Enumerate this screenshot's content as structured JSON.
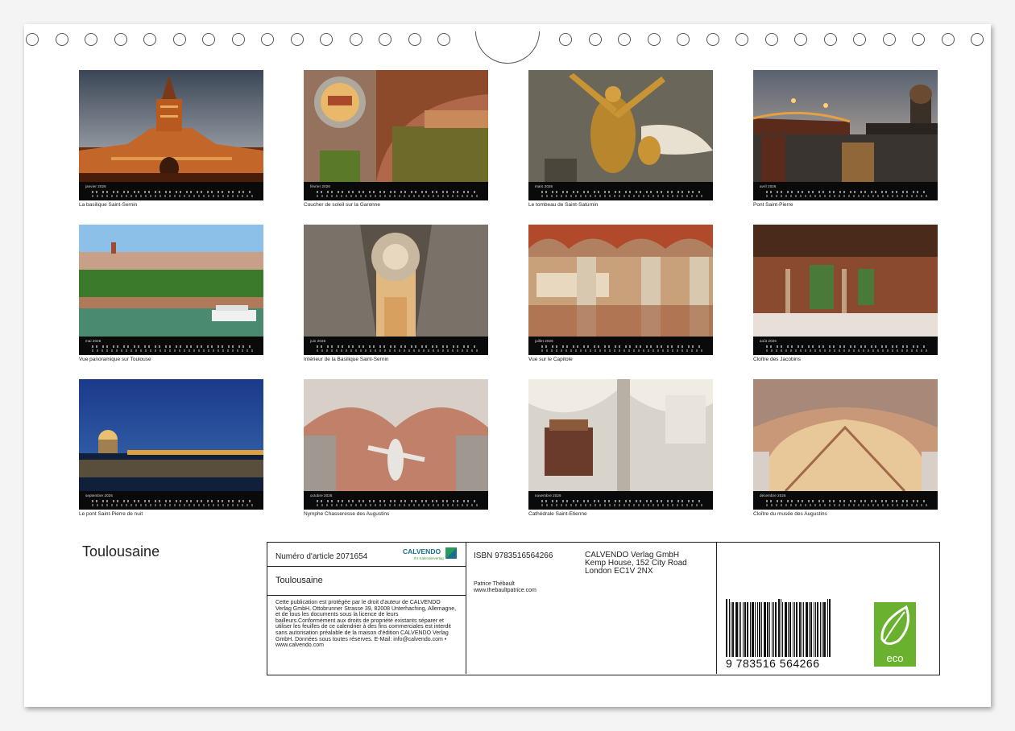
{
  "months": [
    {
      "label": "janvier 2026",
      "caption": "La basilique Saint-Sernin"
    },
    {
      "label": "février 2026",
      "caption": "Coucher de soleil sur la Garonne"
    },
    {
      "label": "mars 2026",
      "caption": "Le tombeau de Saint-Saturnin"
    },
    {
      "label": "avril 2026",
      "caption": "Pont Saint-Pierre"
    },
    {
      "label": "mai 2026",
      "caption": "Vue panoramique sur Toulouse"
    },
    {
      "label": "juin 2026",
      "caption": "Intérieur de la Basilique Saint-Sernin"
    },
    {
      "label": "juillet 2026",
      "caption": "Vue sur le Capitole"
    },
    {
      "label": "août 2026",
      "caption": "Cloître des Jacobins"
    },
    {
      "label": "septembre 2026",
      "caption": "Le pont Saint-Pierre de nuit"
    },
    {
      "label": "octobre 2026",
      "caption": "Nymphe Chasseresse des Augustins"
    },
    {
      "label": "novembre 2026",
      "caption": "Cathédrale Saint-Etienne"
    },
    {
      "label": "décembre 2026",
      "caption": "Cloître du musée des Augustins"
    }
  ],
  "title": "Toulousaine",
  "info": {
    "article": "Numéro d'article 2071654",
    "brand": "CALVENDO",
    "brand_sub": "Ihr Kalenderverlag",
    "calendar_title": "Toulousaine",
    "legal": "Cette publication est protégée par le droit d'auteur de CALVENDO Verlag GmbH, Ottobrunner Strasse 39, 82008 Unterhaching, Allemagne, et de tous les documents sous la licence de leurs bailleurs.Conformément aux droits de propriété existants séparer et utiliser les feuilles de ce calendrier à des fins commerciales est interdit sans autorisation préalable de la maison d'édition CALVENDO Verlag GmbH. Données sous toutes réserves. E-Mail: info@calvendo.com • www.calvendo.com",
    "isbn": "ISBN 9783516564266",
    "publisher_1": "CALVENDO Verlag GmbH",
    "publisher_2": "Kemp House, 152 City Road",
    "publisher_3": "London EC1V 2NX",
    "author_name": "Patrice Thébault",
    "author_url": "www.thebaultpatrice.com",
    "barcode_number": "9 783516 564266",
    "eco_label": "eco"
  },
  "colors": {
    "eco_green": "#6ab12f",
    "brand_blue": "#1a6e8e"
  }
}
